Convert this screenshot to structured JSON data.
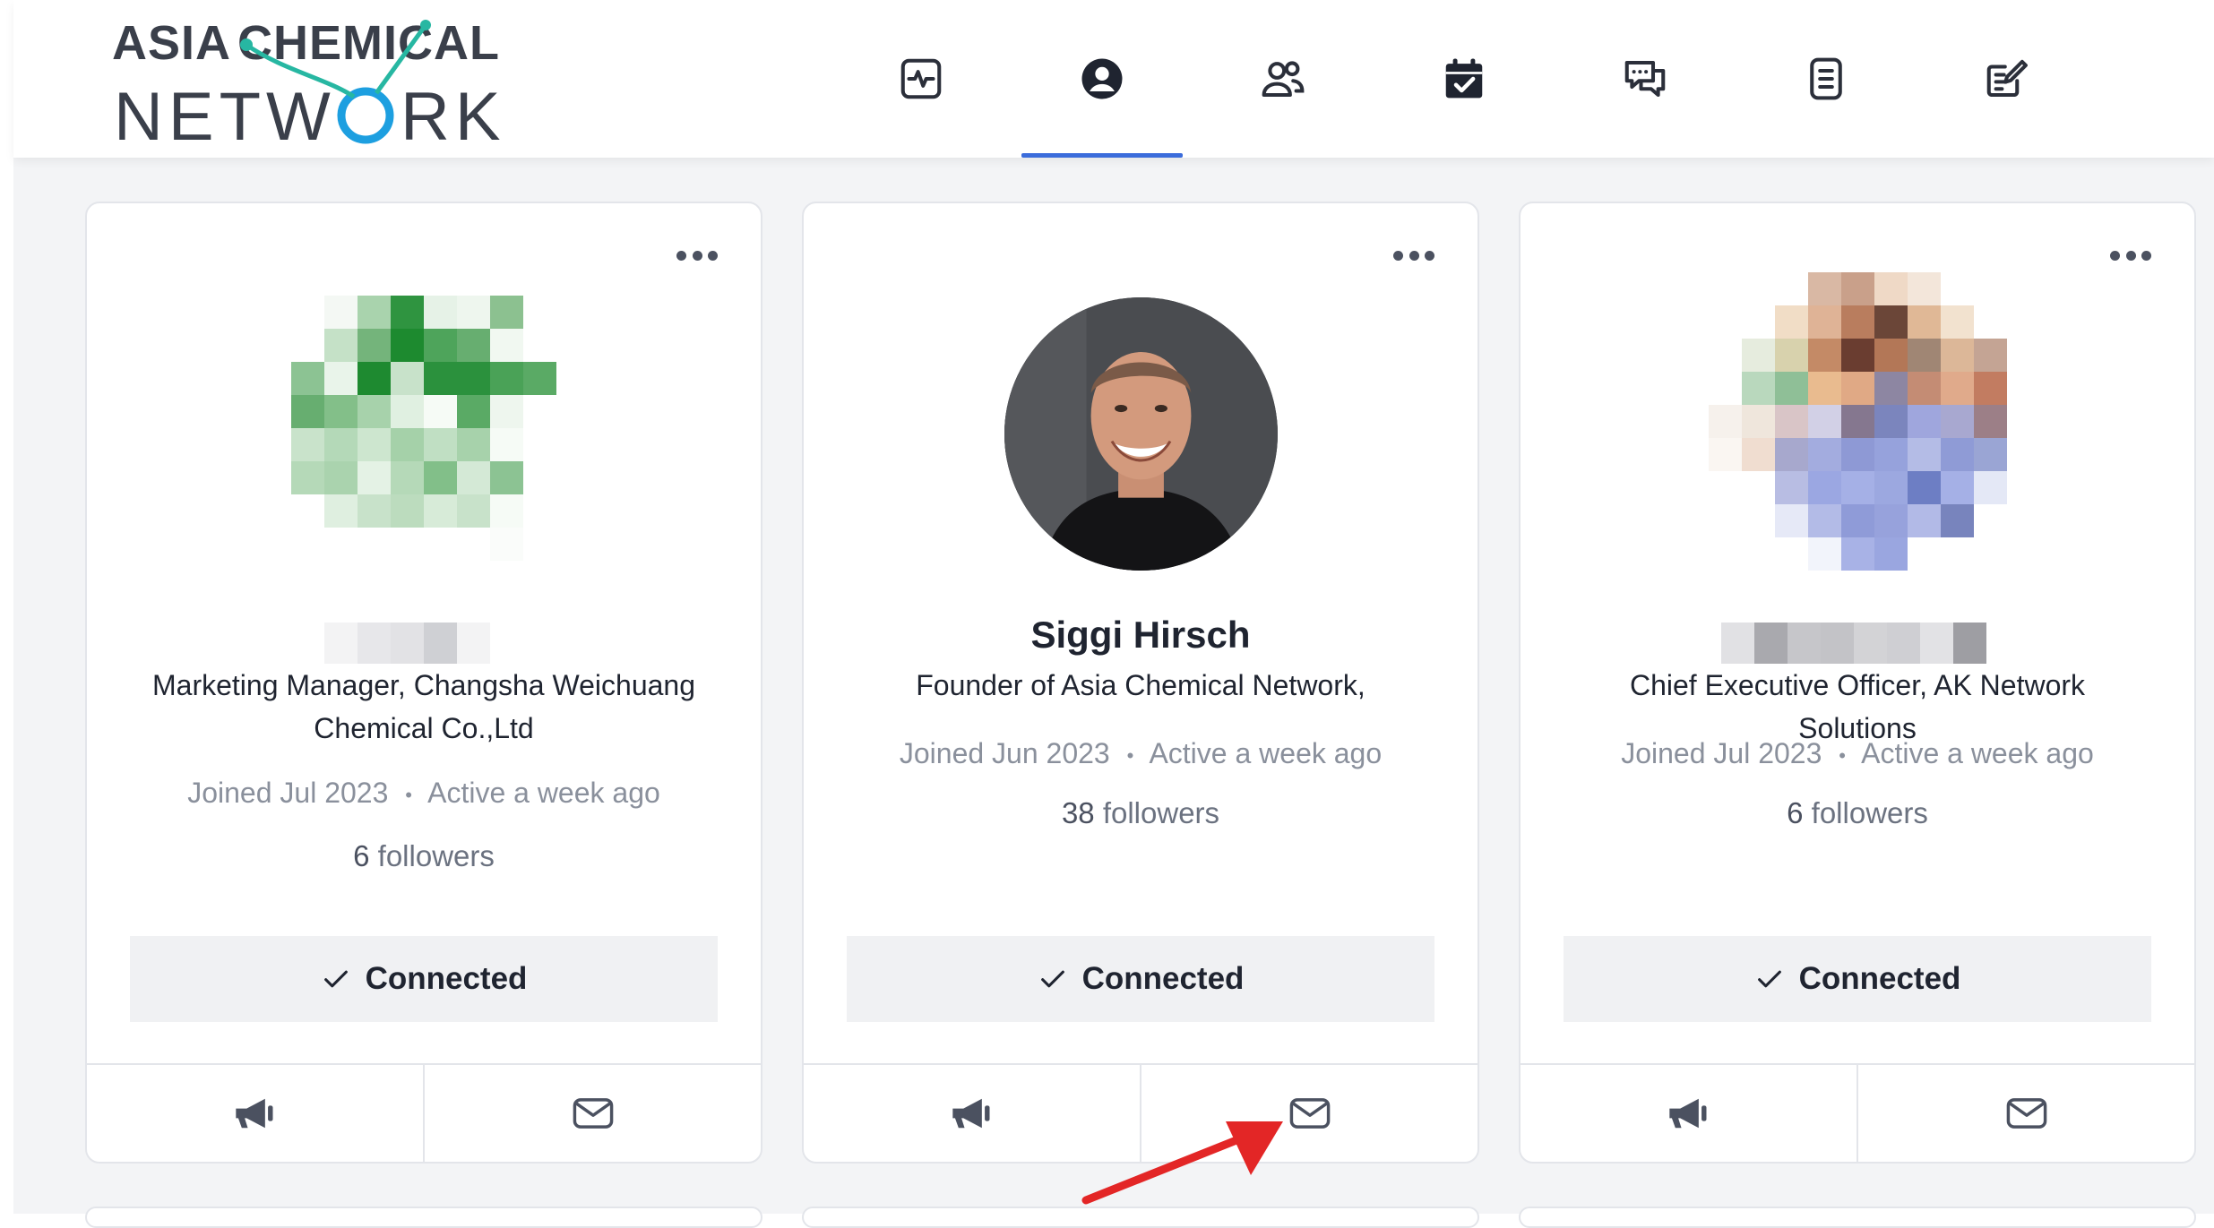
{
  "brand": {
    "line1": "ASIA CHEMICAL",
    "line2": "NETWORK",
    "accent_color": "#27b7a2",
    "accent_color_2": "#1d9fe0"
  },
  "nav": {
    "active_index": 1,
    "items": [
      {
        "icon": "activity-icon"
      },
      {
        "icon": "profile-icon"
      },
      {
        "icon": "connections-icon"
      },
      {
        "icon": "events-calendar-icon"
      },
      {
        "icon": "chat-icon"
      },
      {
        "icon": "document-icon"
      },
      {
        "icon": "edit-note-icon"
      }
    ]
  },
  "cards": [
    {
      "name": "",
      "role": "Marketing Manager, Changsha Weichuang Chemical Co.,Ltd",
      "joined": "Joined Jul 2023",
      "separator": "•",
      "active": "Active a week ago",
      "followers_count": "6",
      "followers_label": "followers",
      "connect_label": "Connected"
    },
    {
      "name": "Siggi Hirsch",
      "role": "Founder of Asia Chemical Network,",
      "joined": "Joined Jun 2023",
      "separator": "•",
      "active": "Active a week ago",
      "followers_count": "38",
      "followers_label": "followers",
      "connect_label": "Connected"
    },
    {
      "name": "",
      "role": "Chief Executive Officer, AK Network Solutions",
      "joined": "Joined Jul 2023",
      "separator": "•",
      "active": "Active a week ago",
      "followers_count": "6",
      "followers_label": "followers",
      "connect_label": "Connected"
    }
  ],
  "annotation": {
    "arrow_color": "#e32626"
  }
}
